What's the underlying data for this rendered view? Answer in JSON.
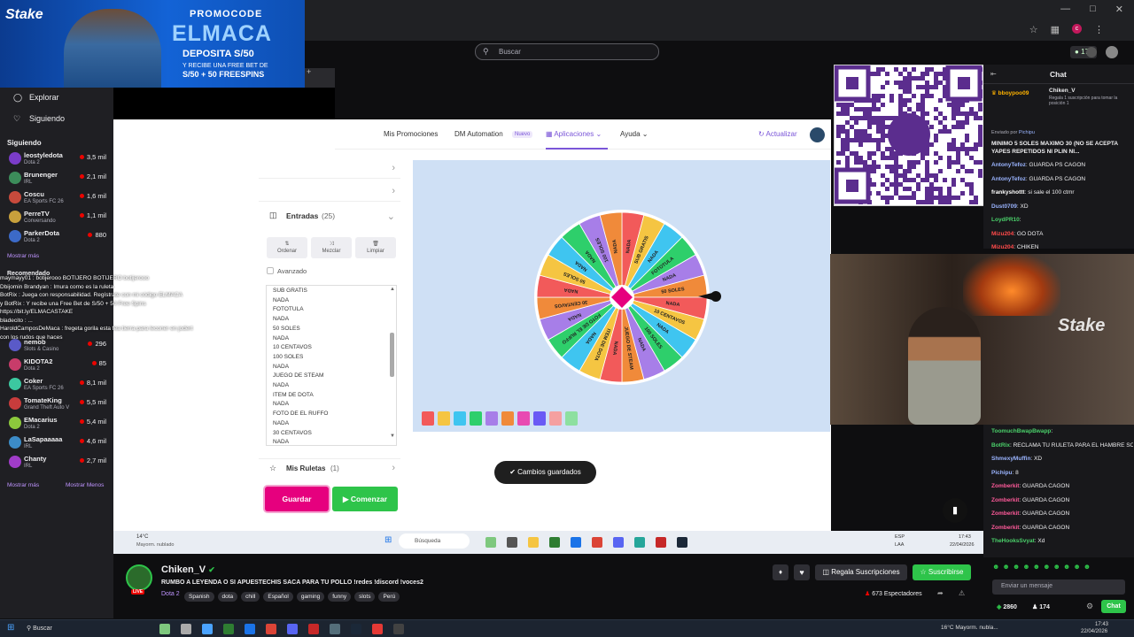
{
  "promo": {
    "brand": "Stake",
    "line1": "PROMOCODE",
    "code": "ELMACA",
    "line3": "DEPOSITA S/50",
    "line4": "Y RECIBE UNA FREE BET DE",
    "line5": "S/50 + 50 FREESPINS"
  },
  "browser": {
    "search_placeholder": "Buscar",
    "viewer_badge": "174",
    "tab_hint": "05"
  },
  "sidebar": {
    "nav": [
      {
        "label": "Explorar",
        "icon": "compass-icon"
      },
      {
        "label": "Siguiendo",
        "icon": "heart-icon"
      }
    ],
    "following_title": "Siguiendo",
    "following": [
      {
        "name": "leostyledota",
        "game": "Dota 2",
        "viewers": "3,5 mil",
        "color": "#7a3cc8"
      },
      {
        "name": "Brunenger",
        "game": "IRL",
        "viewers": "2,1 mil",
        "color": "#3c8c5a"
      },
      {
        "name": "Coscu",
        "game": "EA Sports FC 26",
        "viewers": "1,6 mil",
        "color": "#c84a3c"
      },
      {
        "name": "PerreTV",
        "game": "Conversando",
        "viewers": "1,1 mil",
        "color": "#c8a03c"
      },
      {
        "name": "ParkerDota",
        "game": "Dota 2",
        "viewers": "880",
        "color": "#3c6ac8"
      }
    ],
    "show_more": "Mostrar más",
    "recommended_title": "Recomendado",
    "recommended": [
      {
        "name": "nemob",
        "game": "Slots & Casino",
        "viewers": "296",
        "color": "#5a5ac8"
      },
      {
        "name": "KIDOTA2",
        "game": "Dota 2",
        "viewers": "85",
        "color": "#c83c6a"
      },
      {
        "name": "Coker",
        "game": "EA Sports FC 26",
        "viewers": "8,1 mil",
        "color": "#3cc8a0"
      },
      {
        "name": "TomateKing",
        "game": "Grand Theft Auto V",
        "viewers": "5,5 mil",
        "color": "#c83c3c"
      },
      {
        "name": "EMacarius",
        "game": "Dota 2",
        "viewers": "5,4 mil",
        "color": "#8cc83c"
      },
      {
        "name": "LaSapaaaaa",
        "game": "IRL",
        "viewers": "4,6 mil",
        "color": "#3c8cc8"
      },
      {
        "name": "Chanty",
        "game": "IRL",
        "viewers": "2,7 mil",
        "color": "#a03cc8"
      }
    ],
    "show_more2": "Mostrar más",
    "show_less": "Mostrar Menos",
    "overlay_lines": [
      "maymayy01 : botijerooo BOTIJERO BOTIJERO botijerooo",
      "Dbijomin Brandyan : Imura como es la ruleta",
      "BotRix : Juega con responsabilidad. Regístrate con mi código ELMACA",
      "y BotRix : Y recibe una Free Bet de S/50 + 50 Free Spins",
      "https://bit.ly/ELMACASTAKE",
      "bladecito : ... ",
      "HaroldCamposDeMaca : fregeta gorila esta fea tierra para leconer en jodert",
      "con los rudos que haces"
    ]
  },
  "app": {
    "nav": [
      "Mis Promociones",
      "DM Automation",
      "Nuevo",
      "Aplicaciones",
      "Ayuda",
      "Actualizar"
    ],
    "entries_title": "Entradas",
    "entries_count": "(25)",
    "tools": [
      "Ordenar",
      "Mezclar",
      "Limpiar"
    ],
    "advanced": "Avanzado",
    "entries": [
      "SUB GRATIS",
      "NADA",
      "FOTOTULA",
      "NADA",
      "50 SOLES",
      "NADA",
      "10 CENTAVOS",
      "100 SOLES",
      "NADA",
      "JUEGO DE STEAM",
      "NADA",
      "ITEM DE DOTA",
      "NADA",
      "FOTO DE EL RUFFO",
      "NADA",
      "30 CENTAVOS",
      "NADA"
    ],
    "my_wheels": "Mis Ruletas",
    "my_wheels_count": "(1)",
    "save": "Guardar",
    "start": "Comenzar",
    "toast": "Cambios guardados",
    "wheel_labels": [
      "NADA",
      "SUB GRATIS",
      "NADA",
      "FOTOTULA",
      "NADA",
      "50 SOLES",
      "NADA",
      "10 CENTAVOS",
      "NADA",
      "100 SOLES",
      "NADA",
      "JUEGO DE STEAM",
      "NADA",
      "ITEM DE DOTA",
      "NADA",
      "FOTO DE EL RUFFO",
      "NADA",
      "30 CENTAVOS",
      "NADA",
      "50 SOLES",
      "NADA",
      "NADA",
      "100 SOLES",
      "NADA"
    ],
    "wheel_colors": [
      "#f25a5a",
      "#f5c542",
      "#3fc5f0",
      "#2ecf6b",
      "#a77ee8",
      "#f08a3a"
    ],
    "palette": [
      "#f25a5a",
      "#f5c542",
      "#3fc5f0",
      "#2ecf6b",
      "#a77ee8",
      "#f08a3a",
      "#e84ab2",
      "#6a5af5",
      "#f5a0a0",
      "#8de0a0"
    ]
  },
  "innertask": {
    "weather_temp": "14°C",
    "weather_desc": "Mayorm. nublado",
    "search": "Búsqueda",
    "lang": "ESP",
    "region": "LAA",
    "time": "17:43",
    "date": "22/04/2026"
  },
  "chat": {
    "title": "Chat",
    "pinned_user": "bboypoo09",
    "pinned_user2": "Chiken_V",
    "pinned_note": "Regala 1 suscripción para tomar la posición 1",
    "sent_by": "Enviado por",
    "sent_name": "Pichipu",
    "pinned_msg": "MINIMO 5 SOLES MAXIMO 30 (NO SE ACEPTA YAPES REPETIDOS NI PLIN NI...",
    "messages": [
      {
        "user": "AntonyTefoz",
        "text": "GUARDA PS CAGON",
        "color": "#9ab4ff"
      },
      {
        "user": "AntonyTefoz",
        "text": "GUARDA PS CAGON",
        "color": "#9ab4ff"
      },
      {
        "user": "frankyshottt",
        "text": "si sale el 100 ctmr",
        "color": "#ffffff"
      },
      {
        "user": "Dust0709",
        "text": "XD",
        "color": "#9ab4ff"
      },
      {
        "user": "LoydPR10",
        "text": "",
        "color": "#4ad06a"
      },
      {
        "user": "Mizu204",
        "text": "GO DOTA",
        "color": "#ff4a4a"
      },
      {
        "user": "Mizu204",
        "text": "CHIKEN",
        "color": "#ff4a4a"
      }
    ],
    "messages2": [
      {
        "user": "ToomuchBwapBwapp",
        "text": "",
        "color": "#4ad06a"
      },
      {
        "user": "BotRix",
        "text": "RECLAMA TU RULETA PARA EL HAMBRE SOO PON ISHOP Y CANJEALA",
        "color": "#4ad06a"
      },
      {
        "user": "ShmexyMuffin",
        "text": "XD",
        "color": "#9ab4ff"
      },
      {
        "user": "Pichipu",
        "text": "8",
        "color": "#9ab4ff"
      },
      {
        "user": "Zomberkit",
        "text": "GUARDA CAGON",
        "color": "#ff5a9a"
      },
      {
        "user": "Zomberkit",
        "text": "GUARDA CAGON",
        "color": "#ff5a9a"
      },
      {
        "user": "Zomberkit",
        "text": "GUARDA CAGON",
        "color": "#ff5a9a"
      },
      {
        "user": "Zomberkit",
        "text": "GUARDA CAGON",
        "color": "#ff5a9a"
      },
      {
        "user": "TheHooksSvyat",
        "text": "Xd",
        "color": "#4ad06a"
      }
    ],
    "input_placeholder": "Enviar un mensaje",
    "points": "2860",
    "viewers": "174",
    "chat_button": "Chat"
  },
  "stream": {
    "channel": "Chiken_V",
    "title": "RUMBO A LEYENDA O SI APUESTECHIS SACA PARA TU POLLO !redes !discord !voces2",
    "game": "Dota 2",
    "tags": [
      "Spanish",
      "dota",
      "chill",
      "Español",
      "gaming",
      "funny",
      "slots",
      "Perú"
    ],
    "gift": "Regala Suscripciones",
    "subscribe": "Suscribirse",
    "viewers": "673 Espectadores",
    "live": "LIVE"
  },
  "taskbar": {
    "search": "Buscar",
    "weather": "16°C Mayorm. nubla...",
    "time": "17:43",
    "date": "22/04/2026"
  }
}
